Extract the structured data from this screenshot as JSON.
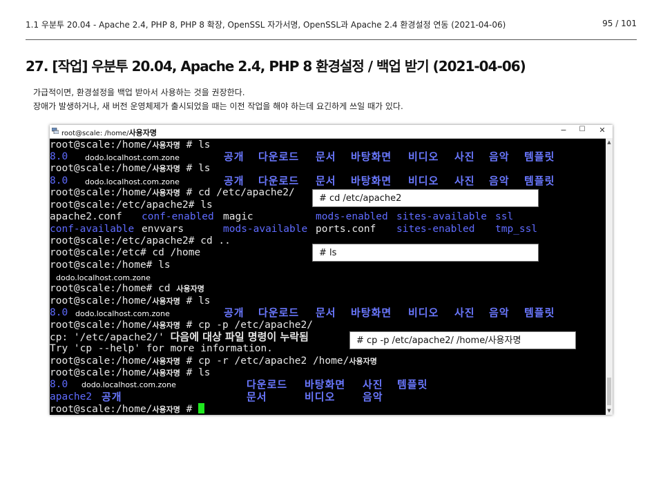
{
  "header": {
    "breadcrumb": "1.1 우분투 20.04 - Apache 2.4, PHP 8, PHP 8 확장, OpenSSL 자가서명, OpenSSL과 Apache 2.4 환경설정 연동 (2021-04-06)",
    "page": "95 / 101"
  },
  "title": "27. [작업] 우분투 20.04, Apache 2.4, PHP 8 환경설정 / 백업 받기 (2021-04-06)",
  "desc": [
    "가급적이면, 환경설정을 백업 받아서 사용하는 것을 권장한다.",
    "장애가 발생하거나, 새 버전 운영체제가 출시되었을 때는 이전 작업을 해야 하는데 요긴하게 쓰일 때가 있다."
  ],
  "window": {
    "title_prefix": "root@scale: /home/",
    "title_user": "사용자명",
    "controls": [
      "−",
      "☐",
      "✕"
    ]
  },
  "terminal": {
    "p_home": "root@scale:/home/",
    "user": "사용자명",
    "cmd_ls": " # ls",
    "v80": "8.0",
    "zone": "dodo.localhost.com.zone",
    "dirs": [
      "공개",
      "다운로드",
      "문서",
      "바탕화면",
      "비디오",
      "사진",
      "음악",
      "템플릿"
    ],
    "cmd_cd_etc": " # cd /etc/apache2/",
    "p_apache_ls": "root@scale:/etc/apache2# ls",
    "apache_row1": [
      "apache2.conf",
      "conf-enabled",
      "magic",
      "mods-enabled",
      "sites-available",
      "ssl"
    ],
    "apache_row2": [
      "conf-available",
      "envvars",
      "mods-available",
      "ports.conf",
      "sites-enabled",
      "tmp_ssl"
    ],
    "p_apache_cd": "root@scale:/etc/apache2# cd ..",
    "p_etc_cd": "root@scale:/etc# cd /home",
    "p_home_ls": "root@scale:/home# ls",
    "p_home_cd": "root@scale:/home# cd ",
    "cmd_cp_p": " # cp -p /etc/apache2/",
    "cp_err_prefix": "cp: '/etc/apache2/' ",
    "cp_err_ko": "다음에 대상 파일 명령이 누락됨",
    "try_help": "Try 'cp --help' for more information.",
    "cmd_cp_r": " # cp -r /etc/apache2 /home/",
    "final_row1": [
      "다운로드",
      "바탕화면",
      "사진",
      "템플릿"
    ],
    "final_row2_blue": "apache2",
    "final_row2": [
      "공개",
      "문서",
      "비디오",
      "음악"
    ],
    "cmd_hash": " # "
  },
  "annotations": [
    "# cd /etc/apache2",
    "# ls",
    "# cp -p /etc/apache2/ /home/사용자명"
  ]
}
